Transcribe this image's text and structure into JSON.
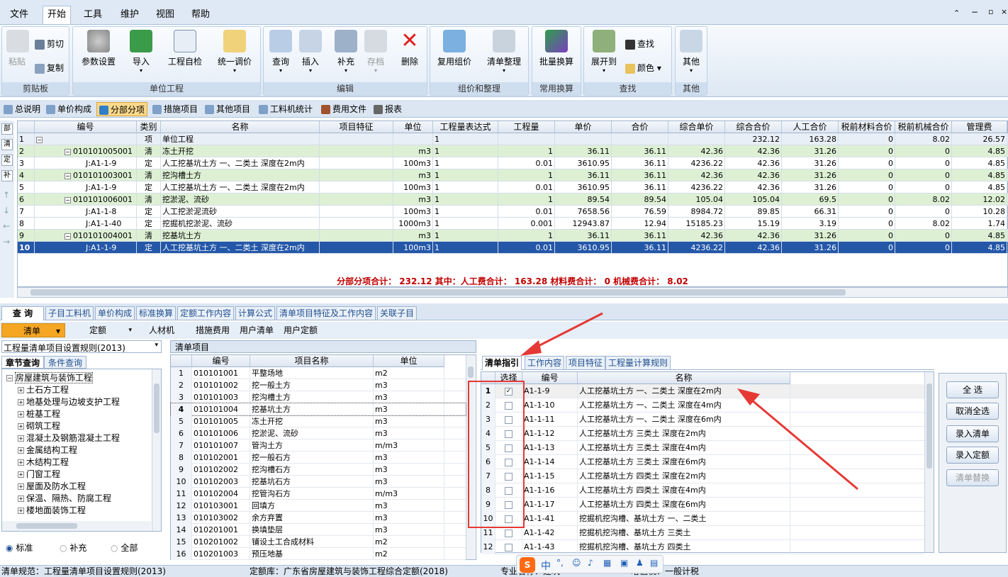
{
  "menu": [
    "文件",
    "开始",
    "工具",
    "维护",
    "视图",
    "帮助"
  ],
  "ribbon": {
    "clipboard": {
      "paste": "粘贴",
      "cut": "剪切",
      "copy": "复制",
      "label": "剪贴板"
    },
    "unit": {
      "params": "参数设置",
      "import": "导入",
      "check": "工程自检",
      "adjust": "统一调价",
      "label": "单位工程"
    },
    "edit": {
      "query": "查询",
      "insert": "插入",
      "supplement": "补充",
      "save": "存档",
      "delete": "删除",
      "label": "编辑"
    },
    "compose": {
      "reuse": "复用组价",
      "organize": "清单整理",
      "label": "组价和整理"
    },
    "convert": {
      "batch": "批量换算",
      "label": "常用换算"
    },
    "find": {
      "expand": "展开到",
      "find": "查找",
      "color": "颜色",
      "label": "查找"
    },
    "other": {
      "other": "其他",
      "label": "其他"
    }
  },
  "tabs2": [
    "总说明",
    "单价构成",
    "分部分项",
    "措施项目",
    "其他项目",
    "工料机统计",
    "费用文件",
    "报表"
  ],
  "rail": [
    "部",
    "清",
    "定",
    "补"
  ],
  "grid": {
    "headers": [
      "编号",
      "类别",
      "名称",
      "项目特征",
      "单位",
      "工程量表达式",
      "工程量",
      "单价",
      "合价",
      "综合单价",
      "综合合价",
      "人工合价",
      "税前材料合价",
      "税前机械合价",
      "管理费"
    ],
    "rows": [
      {
        "n": "1",
        "tree": "⊟",
        "code": "",
        "type": "项",
        "name": "单位工程",
        "feat": "",
        "unit": "",
        "expr": "1",
        "qty": "",
        "price": "",
        "total": "",
        "uprice": "",
        "utotal": "232.12",
        "labor": "163.28",
        "mat": "0",
        "mach": "8.02",
        "mgmt": "26.57",
        "style": "head"
      },
      {
        "n": "2",
        "tree": "⊟",
        "code": "010101005001",
        "type": "清",
        "name": "冻土开挖",
        "feat": "",
        "unit": "m3",
        "expr": "1",
        "qty": "1",
        "price": "36.11",
        "total": "36.11",
        "uprice": "42.36",
        "utotal": "42.36",
        "labor": "31.26",
        "mat": "0",
        "mach": "0",
        "mgmt": "4.85",
        "style": "green"
      },
      {
        "n": "3",
        "tree": "",
        "code": "J:A1-1-9",
        "type": "定",
        "name": "人工挖基坑土方 一、二类土 深度在2m内",
        "feat": "",
        "unit": "100m3",
        "expr": "1",
        "qty": "0.01",
        "price": "3610.95",
        "total": "36.11",
        "uprice": "4236.22",
        "utotal": "42.36",
        "labor": "31.26",
        "mat": "0",
        "mach": "0",
        "mgmt": "4.85",
        "style": ""
      },
      {
        "n": "4",
        "tree": "⊟",
        "code": "010101003001",
        "type": "清",
        "name": "挖沟槽土方",
        "feat": "",
        "unit": "m3",
        "expr": "1",
        "qty": "1",
        "price": "36.11",
        "total": "36.11",
        "uprice": "42.36",
        "utotal": "42.36",
        "labor": "31.26",
        "mat": "0",
        "mach": "0",
        "mgmt": "4.85",
        "style": "green"
      },
      {
        "n": "5",
        "tree": "",
        "code": "J:A1-1-9",
        "type": "定",
        "name": "人工挖基坑土方 一、二类土 深度在2m内",
        "feat": "",
        "unit": "100m3",
        "expr": "1",
        "qty": "0.01",
        "price": "3610.95",
        "total": "36.11",
        "uprice": "4236.22",
        "utotal": "42.36",
        "labor": "31.26",
        "mat": "0",
        "mach": "0",
        "mgmt": "4.85",
        "style": ""
      },
      {
        "n": "6",
        "tree": "⊟",
        "code": "010101006001",
        "type": "清",
        "name": "挖淤泥、流砂",
        "feat": "",
        "unit": "m3",
        "expr": "1",
        "qty": "1",
        "price": "89.54",
        "total": "89.54",
        "uprice": "105.04",
        "utotal": "105.04",
        "labor": "69.5",
        "mat": "0",
        "mach": "8.02",
        "mgmt": "12.02",
        "style": "green"
      },
      {
        "n": "7",
        "tree": "",
        "code": "J:A1-1-8",
        "type": "定",
        "name": "人工挖淤泥流砂",
        "feat": "",
        "unit": "100m3",
        "expr": "1",
        "qty": "0.01",
        "price": "7658.56",
        "total": "76.59",
        "uprice": "8984.72",
        "utotal": "89.85",
        "labor": "66.31",
        "mat": "0",
        "mach": "0",
        "mgmt": "10.28",
        "style": ""
      },
      {
        "n": "8",
        "tree": "",
        "code": "J:A1-1-40",
        "type": "定",
        "name": "挖掘机挖淤泥、流砂",
        "feat": "",
        "unit": "1000m3",
        "expr": "1",
        "qty": "0.001",
        "price": "12943.87",
        "total": "12.94",
        "uprice": "15185.23",
        "utotal": "15.19",
        "labor": "3.19",
        "mat": "0",
        "mach": "8.02",
        "mgmt": "1.74",
        "style": ""
      },
      {
        "n": "9",
        "tree": "⊟",
        "code": "010101004001",
        "type": "清",
        "name": "挖基坑土方",
        "feat": "",
        "unit": "m3",
        "expr": "1",
        "qty": "1",
        "price": "36.11",
        "total": "36.11",
        "uprice": "42.36",
        "utotal": "42.36",
        "labor": "31.26",
        "mat": "0",
        "mach": "0",
        "mgmt": "4.85",
        "style": "green"
      },
      {
        "n": "10",
        "tree": "",
        "code": "J:A1-1-9",
        "type": "定",
        "name": "人工挖基坑土方 一、二类土 深度在2m内",
        "feat": "",
        "unit": "100m3",
        "expr": "1",
        "qty": "0.01",
        "price": "3610.95",
        "total": "36.11",
        "uprice": "4236.22",
        "utotal": "42.36",
        "labor": "31.26",
        "mat": "0",
        "mach": "0",
        "mgmt": "4.85",
        "style": "sel"
      }
    ]
  },
  "summary": "分部分项合计：  232.12    其中：人工费合计：  163.28    材料费合计：  0    机械费合计：  8.02",
  "btabs": [
    "查 询",
    "子目工料机",
    "单价构成",
    "标准换算",
    "定额工作内容",
    "计算公式",
    "清单项目特征及工作内容",
    "关联子目"
  ],
  "subbar": [
    "清单",
    "定额",
    "人材机",
    "措施费用",
    "用户清单",
    "用户定额"
  ],
  "rules_select": "工程量清单项目设置规则(2013)",
  "tree_tabs": [
    "章节查询",
    "条件查询"
  ],
  "tree": [
    "房屋建筑与装饰工程",
    "土石方工程",
    "地基处理与边坡支护工程",
    "桩基工程",
    "砌筑工程",
    "混凝土及钢筋混凝土工程",
    "金属结构工程",
    "木结构工程",
    "门窗工程",
    "屋面及防水工程",
    "保温、隔热、防腐工程",
    "楼地面装饰工程"
  ],
  "radios": [
    "标准",
    "补充",
    "全部"
  ],
  "list": {
    "title": "清单项目",
    "headers": [
      "编号",
      "项目名称",
      "单位"
    ],
    "rows": [
      [
        "1",
        "010101001",
        "平整场地",
        "m2"
      ],
      [
        "2",
        "010101002",
        "挖一般土方",
        "m3"
      ],
      [
        "3",
        "010101003",
        "挖沟槽土方",
        "m3"
      ],
      [
        "4",
        "010101004",
        "挖基坑土方",
        "m3"
      ],
      [
        "5",
        "010101005",
        "冻土开挖",
        "m3"
      ],
      [
        "6",
        "010101006",
        "挖淤泥、流砂",
        "m3"
      ],
      [
        "7",
        "010101007",
        "管沟土方",
        "m/m3"
      ],
      [
        "8",
        "010102001",
        "挖一般石方",
        "m3"
      ],
      [
        "9",
        "010102002",
        "挖沟槽石方",
        "m3"
      ],
      [
        "10",
        "010102003",
        "挖基坑石方",
        "m3"
      ],
      [
        "11",
        "010102004",
        "挖管沟石方",
        "m/m3"
      ],
      [
        "12",
        "010103001",
        "回填方",
        "m3"
      ],
      [
        "13",
        "010103002",
        "余方弃置",
        "m3"
      ],
      [
        "14",
        "010201001",
        "换填垫层",
        "m3"
      ],
      [
        "15",
        "010201002",
        "铺设土工合成材料",
        "m2"
      ],
      [
        "16",
        "010201003",
        "预压地基",
        "m2"
      ]
    ]
  },
  "right_tabs": [
    "清单指引",
    "工作内容",
    "项目特征",
    "工程量计算规则"
  ],
  "guide": {
    "headers": [
      "选择",
      "编号",
      "名称"
    ],
    "rows": [
      [
        "1",
        "✓",
        "A1-1-9",
        "人工挖基坑土方 一、二类土 深度在2m内"
      ],
      [
        "2",
        "",
        "A1-1-10",
        "人工挖基坑土方 一、二类土 深度在4m内"
      ],
      [
        "3",
        "",
        "A1-1-11",
        "人工挖基坑土方 一、二类土 深度在6m内"
      ],
      [
        "4",
        "",
        "A1-1-12",
        "人工挖基坑土方 三类土 深度在2m内"
      ],
      [
        "5",
        "",
        "A1-1-13",
        "人工挖基坑土方 三类土 深度在4m内"
      ],
      [
        "6",
        "",
        "A1-1-14",
        "人工挖基坑土方 三类土 深度在6m内"
      ],
      [
        "7",
        "",
        "A1-1-15",
        "人工挖基坑土方 四类土 深度在2m内"
      ],
      [
        "8",
        "",
        "A1-1-16",
        "人工挖基坑土方 四类土 深度在4m内"
      ],
      [
        "9",
        "",
        "A1-1-17",
        "人工挖基坑土方 四类土 深度在6m内"
      ],
      [
        "10",
        "",
        "A1-1-41",
        "挖掘机挖沟槽、基坑土方 一、二类土"
      ],
      [
        "11",
        "",
        "A1-1-42",
        "挖掘机挖沟槽、基坑土方 三类土"
      ],
      [
        "12",
        "",
        "A1-1-43",
        "挖掘机挖沟槽、基坑土方 四类土"
      ]
    ]
  },
  "action_buttons": [
    "全 选",
    "取消全选",
    "录入清单",
    "录入定额",
    "清单替换"
  ],
  "status": {
    "left": "清单规范：工程量清单项目设置规则(2013)",
    "mid": "定额库：广东省房屋建筑与装饰工程综合定额(2018)",
    "right1": "专业名称：建筑",
    "right2": "增值税：一般计税"
  },
  "ime": "中",
  "colors": {
    "accent": "#2457a8",
    "green": "#ddf0d4",
    "orange": "#f5a623",
    "arrow": "#e53935"
  }
}
